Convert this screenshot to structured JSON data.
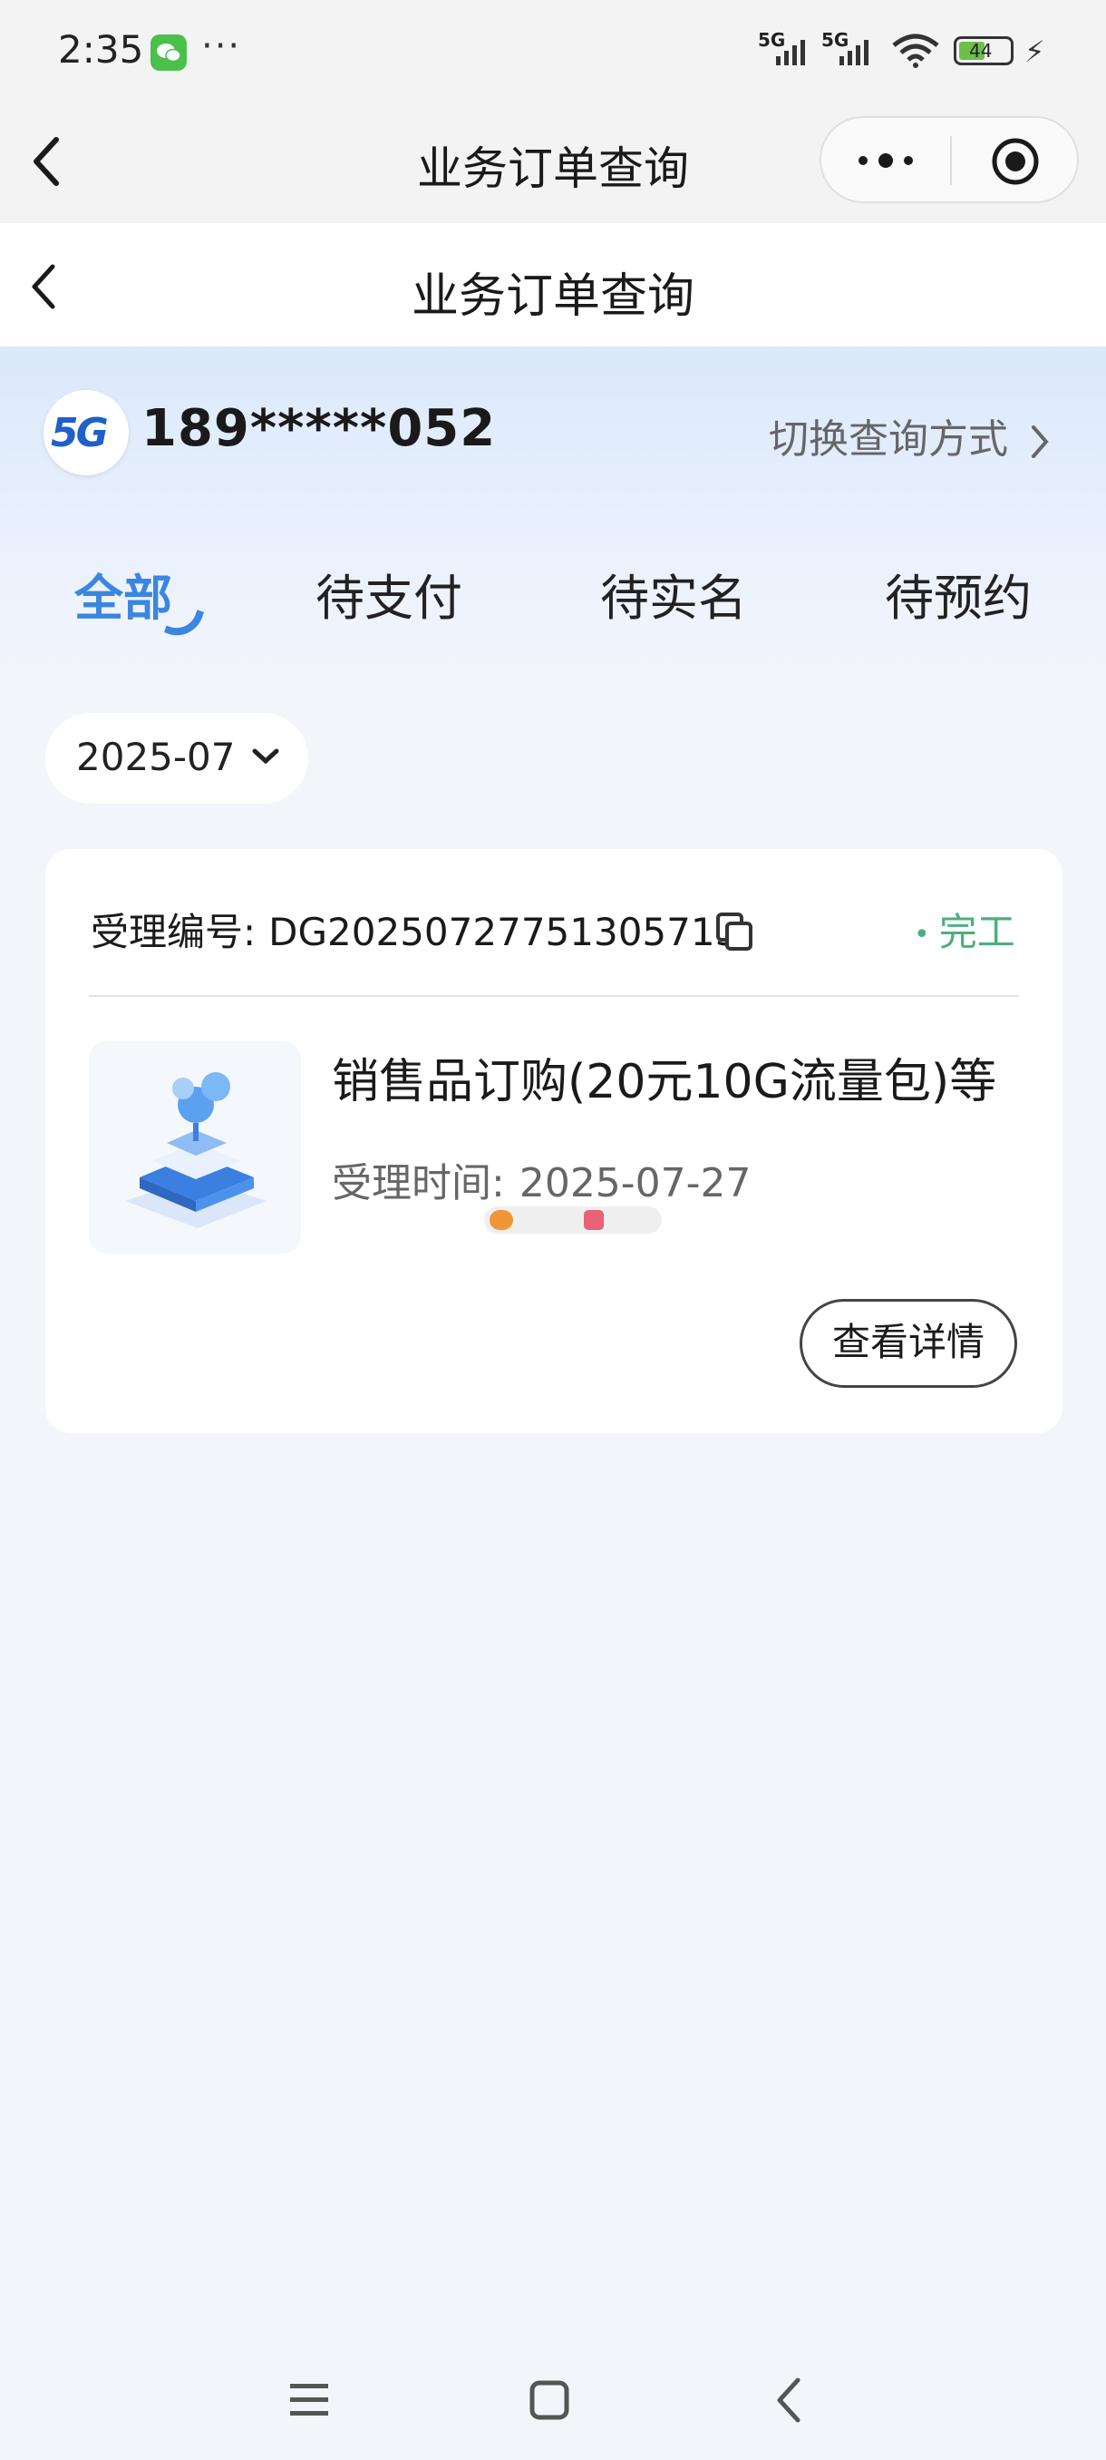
{
  "status_bar": {
    "time": "2:35",
    "dots": "···",
    "net1": "5G",
    "net2": "5G",
    "battery": "44"
  },
  "mini_program": {
    "title": "业务订单查询"
  },
  "page": {
    "title": "业务订单查询",
    "phone": "189*****052",
    "switch_label": "切换查询方式",
    "badge_text": "5G"
  },
  "tabs": [
    {
      "label": "全部",
      "active": true
    },
    {
      "label": "待支付",
      "active": false
    },
    {
      "label": "待实名",
      "active": false
    },
    {
      "label": "待预约",
      "active": false
    }
  ],
  "date_filter": "2025-07",
  "order": {
    "number_label": "受理编号:",
    "number": "DG20250727751305713",
    "status": "完工",
    "product": "销售品订购(20元10G流量包)等",
    "time_label": "受理时间:",
    "time": "2025-07-27",
    "detail_button": "查看详情"
  },
  "colors": {
    "accent": "#3a86e0",
    "status_done": "#4caf7d",
    "background": "#f3f5fb"
  }
}
